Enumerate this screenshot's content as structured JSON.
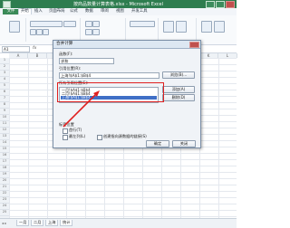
{
  "window": {
    "title": "按商品数量计算表格.xlsx - Microsoft Excel"
  },
  "ribbon_tabs": [
    "文件",
    "开始",
    "插入",
    "页面布局",
    "公式",
    "数据",
    "审阅",
    "视图",
    "开发工具"
  ],
  "formula_bar": {
    "cell_ref": "A1",
    "fx": "fx",
    "content": ""
  },
  "columns": [
    "A",
    "B",
    "C",
    "D",
    "E",
    "F",
    "G",
    "H",
    "I",
    "J",
    "K",
    "L"
  ],
  "rows": [
    "1",
    "2",
    "3",
    "4",
    "5",
    "6",
    "7",
    "8",
    "9",
    "10",
    "11",
    "12",
    "13",
    "14",
    "15",
    "16",
    "17",
    "18",
    "19",
    "20",
    "21",
    "22",
    "23",
    "24",
    "25"
  ],
  "sheet_tabs": [
    "一月",
    "二月",
    "上海",
    "统计"
  ],
  "dialog": {
    "title": "合并计算",
    "function_label": "函数(F):",
    "function_value": "求和",
    "reference_label": "引用位置(R):",
    "reference_value": "上海!$A$1:$B$4",
    "browse_label": "浏览(B)...",
    "all_refs_label": "所有引用位置(E):",
    "refs": [
      "一月!$A$1:$B$4",
      "二月!$A$1:$B$4",
      "上海!$A$1:$B$4"
    ],
    "selected_ref_index": 2,
    "add_label": "添加(A)",
    "delete_label": "删除(D)",
    "labels_group": "标签位置",
    "first_row_label": "首行(T)",
    "left_column_label": "最左列(L)",
    "link_label": "创建指向源数据的链接(S)",
    "ok_label": "确定",
    "close_label": "关闭"
  },
  "colors": {
    "excel_green": "#2e7d4f",
    "highlight": "#e02020",
    "selection": "#3f6fc6"
  }
}
